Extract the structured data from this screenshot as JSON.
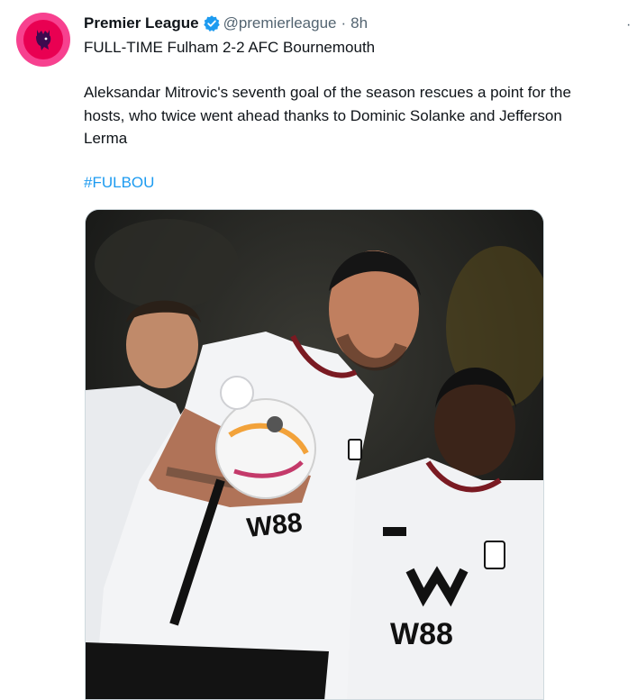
{
  "tweet": {
    "author_name": "Premier League",
    "handle": "@premierleague",
    "separator": "·",
    "timestamp": "8h",
    "text_lines": [
      "FULL-TIME Fulham 2-2 AFC Bournemouth",
      "Aleksandar Mitrovic's seventh goal of the season rescues a point for the",
      "hosts, who twice went ahead thanks to Dominic Solanke and Jefferson",
      "Lerma"
    ],
    "hashtag": "#FULBOU",
    "more_icon": "ellipsis-icon",
    "verified_icon": "verified-badge-icon",
    "media_sponsor_text": "W88"
  },
  "colors": {
    "accent": "#1d9bf0",
    "avatar_bg": "#f7418f",
    "text": "#0f1419",
    "muted": "#536471"
  }
}
